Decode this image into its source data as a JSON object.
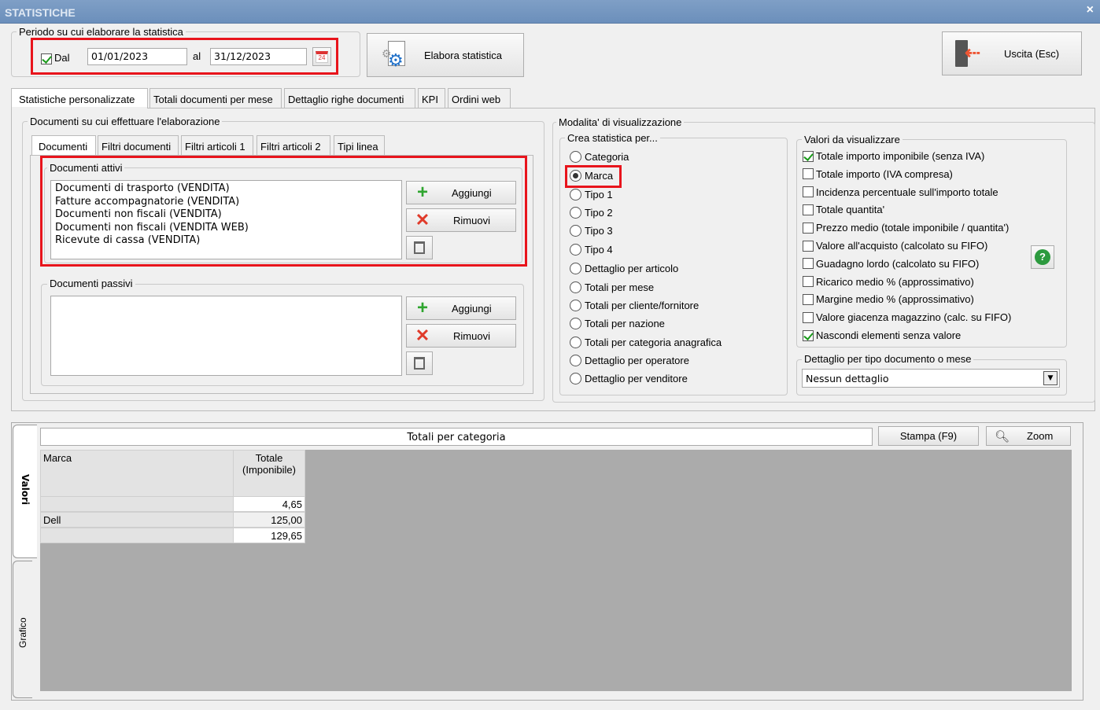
{
  "window": {
    "title": "STATISTICHE",
    "close": "×"
  },
  "period": {
    "legend": "Periodo su cui elaborare la statistica",
    "dal_label": "Dal",
    "dal_checked": true,
    "from": "01/01/2023",
    "al_label": "al",
    "to": "31/12/2023",
    "calendar_day": "24"
  },
  "buttons": {
    "elabora": "Elabora statistica",
    "uscita": "Uscita (Esc)"
  },
  "tabs": [
    "Statistiche personalizzate",
    "Totali documenti per mese",
    "Dettaglio righe documenti",
    "KPI",
    "Ordini web"
  ],
  "documenti": {
    "legend": "Documenti su cui effettuare l'elaborazione",
    "tabs": [
      "Documenti",
      "Filtri documenti",
      "Filtri articoli 1",
      "Filtri articoli 2",
      "Tipi linea"
    ],
    "attivi": {
      "legend": "Documenti attivi",
      "items": [
        "Documenti di trasporto (VENDITA)",
        "Fatture accompagnatorie (VENDITA)",
        "Documenti non fiscali (VENDITA)",
        "Documenti non fiscali (VENDITA WEB)",
        "Ricevute di cassa (VENDITA)"
      ]
    },
    "passivi": {
      "legend": "Documenti passivi",
      "items": []
    },
    "aggiungi": "Aggiungi",
    "rimuovi": "Rimuovi"
  },
  "modalita": {
    "legend": "Modalita' di visualizzazione",
    "crea": {
      "legend": "Crea statistica per...",
      "selected": "Marca",
      "options": [
        "Categoria",
        "Marca",
        "Tipo 1",
        "Tipo 2",
        "Tipo 3",
        "Tipo 4",
        "Dettaglio per articolo",
        "Totali per mese",
        "Totali per cliente/fornitore",
        "Totali per nazione",
        "Totali per categoria anagrafica",
        "Dettaglio per operatore",
        "Dettaglio per venditore"
      ]
    },
    "valori": {
      "legend": "Valori da visualizzare",
      "options": [
        {
          "label": "Totale importo imponibile (senza IVA)",
          "checked": true
        },
        {
          "label": "Totale importo (IVA compresa)",
          "checked": false
        },
        {
          "label": "Incidenza percentuale sull'importo totale",
          "checked": false
        },
        {
          "label": "Totale quantita'",
          "checked": false
        },
        {
          "label": "Prezzo medio (totale imponibile / quantita')",
          "checked": false
        },
        {
          "label": "Valore all'acquisto (calcolato su FIFO)",
          "checked": false
        },
        {
          "label": "Guadagno lordo (calcolato su FIFO)",
          "checked": false
        },
        {
          "label": "Ricarico medio % (approssimativo)",
          "checked": false
        },
        {
          "label": "Margine medio % (approssimativo)",
          "checked": false
        },
        {
          "label": "Valore giacenza magazzino (calc. su FIFO)",
          "checked": false
        },
        {
          "label": "Nascondi elementi senza valore",
          "checked": true
        }
      ]
    },
    "dettaglio": {
      "legend": "Dettaglio per tipo documento o mese",
      "value": "Nessun dettaglio"
    }
  },
  "results": {
    "side_tabs": [
      "Valori",
      "Grafico"
    ],
    "header": "Totali per categoria",
    "stampa": "Stampa (F9)",
    "zoom": "Zoom",
    "columns": [
      "Marca",
      "Totale\n(Imponibile)"
    ],
    "rows": [
      [
        "",
        "4,65"
      ],
      [
        "Dell",
        "125,00"
      ],
      [
        "",
        "129,65"
      ]
    ]
  }
}
